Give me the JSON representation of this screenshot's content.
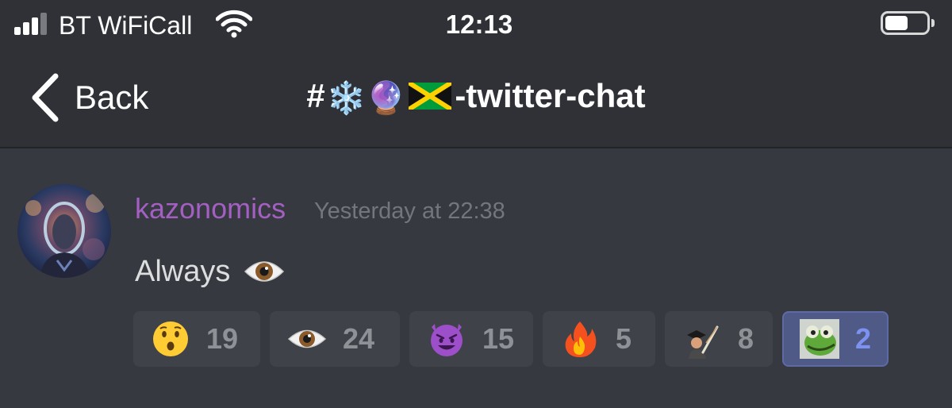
{
  "status_bar": {
    "carrier": "BT WiFiCall",
    "time": "12:13",
    "battery_level": 0.6,
    "signal_bars": 3,
    "signal_bars_total": 4
  },
  "nav": {
    "back_label": "Back",
    "channel": {
      "hash": "#",
      "emoji_snowflake": "❄️",
      "emoji_crystal_ball": "🔮",
      "flag_icon": "jamaica-flag-icon",
      "suffix": "-twitter-chat"
    }
  },
  "message": {
    "author": "kazonomics",
    "author_color": "#a35fc1",
    "timestamp": "Yesterday at 22:38",
    "text": "Always",
    "text_emoji_icon": "eye-icon"
  },
  "reactions": [
    {
      "icon": "hushed-face-icon",
      "count": "19",
      "active": false
    },
    {
      "icon": "eye-icon",
      "count": "24",
      "active": false
    },
    {
      "icon": "smiling-imp-icon",
      "count": "15",
      "active": false
    },
    {
      "icon": "fire-icon",
      "count": "5",
      "active": false
    },
    {
      "icon": "custom-emoji-icon",
      "count": "8",
      "active": false
    },
    {
      "icon": "kermit-emoji-icon",
      "count": "2",
      "active": true
    }
  ],
  "colors": {
    "background": "#36393f",
    "header": "#2f3136",
    "reaction_bg": "#3f4248",
    "reaction_active_bg": "#4f5a87",
    "reaction_active_text": "#7d91f0"
  }
}
